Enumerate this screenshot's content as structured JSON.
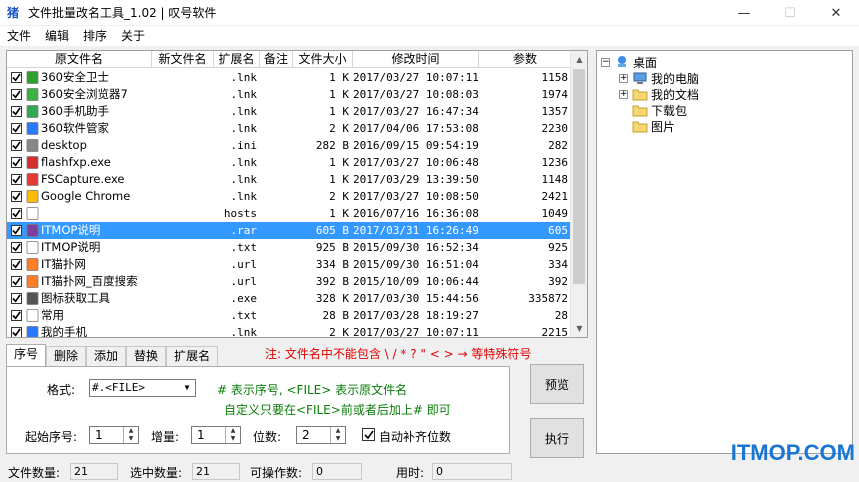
{
  "window": {
    "title": "文件批量改名工具_1.02 | 叹号软件",
    "icon_label": "猪",
    "controls": {
      "minimize": "—",
      "maximize": "☐",
      "close": "✕"
    }
  },
  "menu": [
    "文件",
    "编辑",
    "排序",
    "关于"
  ],
  "columns": [
    "原文件名",
    "新文件名",
    "扩展名",
    "备注",
    "文件大小",
    "修改时间",
    "参数"
  ],
  "rows": [
    {
      "name": "360安全卫士",
      "ext": ".lnk",
      "size": "1 K",
      "time": "2017/03/27  10:07:11",
      "param": "1158",
      "icon": "shield-icon",
      "color": "#2ea02e"
    },
    {
      "name": "360安全浏览器7",
      "ext": ".lnk",
      "size": "1 K",
      "time": "2017/03/27  10:08:03",
      "param": "1974",
      "icon": "browser-icon",
      "color": "#3cb043"
    },
    {
      "name": "360手机助手",
      "ext": ".lnk",
      "size": "1 K",
      "time": "2017/03/27  16:47:34",
      "param": "1357",
      "icon": "phone-icon",
      "color": "#33a852"
    },
    {
      "name": "360软件管家",
      "ext": ".lnk",
      "size": "2 K",
      "time": "2017/04/06  17:53:08",
      "param": "2230",
      "icon": "software-icon",
      "color": "#2979ff"
    },
    {
      "name": "desktop",
      "ext": ".ini",
      "size": "282 B",
      "time": "2016/09/15  09:54:19",
      "param": "282",
      "icon": "settings-file-icon",
      "color": "#888888"
    },
    {
      "name": "flashfxp.exe",
      "ext": ".lnk",
      "size": "1 K",
      "time": "2017/03/27  10:06:48",
      "param": "1236",
      "icon": "ftp-icon",
      "color": "#d32f2f"
    },
    {
      "name": "FSCapture.exe",
      "ext": ".lnk",
      "size": "1 K",
      "time": "2017/03/29  13:39:50",
      "param": "1148",
      "icon": "capture-icon",
      "color": "#e53935"
    },
    {
      "name": "Google Chrome",
      "ext": ".lnk",
      "size": "2 K",
      "time": "2017/03/27  10:08:50",
      "param": "2421",
      "icon": "chrome-icon",
      "color": "#fbbc05"
    },
    {
      "name": "",
      "ext": "hosts",
      "size": "1 K",
      "time": "2016/07/16  16:36:08",
      "param": "1049",
      "icon": "blank-file-icon",
      "color": "#ffffff"
    },
    {
      "name": "ITMOP说明",
      "ext": ".rar",
      "size": "605 B",
      "time": "2017/03/31  16:26:49",
      "param": "605",
      "icon": "archive-icon",
      "color": "#7b3fa0",
      "selected": true
    },
    {
      "name": "ITMOP说明",
      "ext": ".txt",
      "size": "925 B",
      "time": "2015/09/30  16:52:34",
      "param": "925",
      "icon": "text-file-icon",
      "color": "#ffffff"
    },
    {
      "name": "IT猫扑网",
      "ext": ".url",
      "size": "334 B",
      "time": "2015/09/30  16:51:04",
      "param": "334",
      "icon": "url-icon",
      "color": "#ff7f27"
    },
    {
      "name": "IT猫扑网_百度搜索",
      "ext": ".url",
      "size": "392 B",
      "time": "2015/10/09  10:06:44",
      "param": "392",
      "icon": "url-icon",
      "color": "#ff7f27"
    },
    {
      "name": "图标获取工具",
      "ext": ".exe",
      "size": "328 K",
      "time": "2017/03/30  15:44:56",
      "param": "335872",
      "icon": "tool-icon",
      "color": "#555555"
    },
    {
      "name": "常用",
      "ext": ".txt",
      "size": "28 B",
      "time": "2017/03/28  18:19:27",
      "param": "28",
      "icon": "text-file-icon",
      "color": "#ffffff"
    },
    {
      "name": "我的手机",
      "ext": ".lnk",
      "size": "2 K",
      "time": "2017/03/27  10:07:11",
      "param": "2215",
      "icon": "phone-icon",
      "color": "#2979ff"
    }
  ],
  "tree": {
    "root": "桌面",
    "children": [
      "我的电脑",
      "我的文档",
      "下载包",
      "图片"
    ]
  },
  "tabs": [
    "序号",
    "删除",
    "添加",
    "替换",
    "扩展名"
  ],
  "warning": "注: 文件名中不能包含 \\ /  * ? \" < > → 等特殊符号",
  "panel": {
    "format_label": "格式:",
    "format_value": "#.<FILE>",
    "hint1": "# 表示序号, <FILE> 表示原文件名",
    "hint2": "自定义只要在<FILE>前或者后加上# 即可",
    "start_label": "起始序号:",
    "start_value": "1",
    "step_label": "增量:",
    "step_value": "1",
    "digits_label": "位数:",
    "digits_value": "2",
    "autofill_label": "自动补齐位数"
  },
  "buttons": {
    "preview": "预览",
    "execute": "执行"
  },
  "status": {
    "file_count_label": "文件数量:",
    "file_count": "21",
    "selected_label": "选中数量:",
    "selected": "21",
    "operable_label": "可操作数:",
    "operable": "0",
    "time_label": "用时:",
    "time": "0"
  },
  "watermark": "ITMOP.COM"
}
